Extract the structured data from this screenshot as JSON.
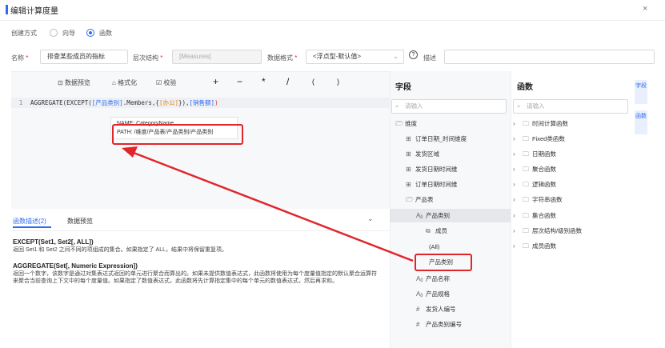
{
  "dialog": {
    "title": "编辑计算度量",
    "close": "×"
  },
  "create_mode": {
    "label": "创建方式",
    "options": [
      {
        "label": "向导",
        "selected": false
      },
      {
        "label": "函数",
        "selected": true
      }
    ]
  },
  "form": {
    "name_label": "名称",
    "name_value": "排查某些成员的指标",
    "hierarchy_label": "层次结构",
    "hierarchy_value": "[Measures]",
    "format_label": "数据格式",
    "format_value": "<浮点型-默认值>",
    "desc_label": "描述",
    "required_mark": "*"
  },
  "toolbar": {
    "preview": "数据预览",
    "format": "格式化",
    "validate": "校验",
    "ops": [
      "+",
      "−",
      "*",
      "/",
      "(",
      ")"
    ]
  },
  "code": {
    "line_no": "1",
    "prefix": "AGGREGATE(EXCEPT(",
    "tok1": "[产品类别]",
    "mid1": ".Members,{",
    "tok2": "[办公]",
    "mid2": "}),",
    "tok3": "[销售额]",
    "suffix": ")"
  },
  "popup": {
    "name_line": "NAME: CategoryName",
    "path_line": "PATH: /维度/产品表/产品类别/产品类别"
  },
  "desc_tabs": {
    "tab1": "函数描述(2)",
    "tab2": "数据预览"
  },
  "descriptions": [
    {
      "head": "EXCEPT(Set1, Set2[, ALL])",
      "body": "返回 Set1 和 Set2 之间不同的项组成的集合。如果指定了 ALL，结果中将保留重复项。"
    },
    {
      "head": "AGGREGATE(Set[, Numeric Expression])",
      "body": "返回一个数字，该数字是通过对集表达式返回的单元进行聚合而算出的。如果未提供数值表达式，此函数将使用为每个度量值指定的默认聚合运算符来聚合当前查询上下文中的每个度量值。如果指定了数值表达式，此函数将先计算指定集中的每个单元的数值表达式，然后再求和。"
    }
  ],
  "fields": {
    "title": "字段",
    "search_placeholder": "请输入",
    "items": [
      {
        "label": "维度",
        "icon": "folder-open-icon"
      },
      {
        "label": "订单日期_时间维度",
        "icon": "hierarchy-icon"
      },
      {
        "label": "发货区域",
        "icon": "hierarchy-icon"
      },
      {
        "label": "发货日期时间维",
        "icon": "hierarchy-icon"
      },
      {
        "label": "订单日期时间维",
        "icon": "hierarchy-icon"
      },
      {
        "label": "产品表",
        "icon": "folder-open-icon"
      },
      {
        "label": "产品类别",
        "icon": "text-field-icon"
      },
      {
        "label": "成员",
        "icon": "member-icon"
      },
      {
        "label": "(All)",
        "icon": ""
      },
      {
        "label": "产品类别",
        "icon": ""
      },
      {
        "label": "产品名称",
        "icon": "text-field-icon"
      },
      {
        "label": "产品规格",
        "icon": "text-field-icon"
      },
      {
        "label": "发货人编号",
        "icon": "hash-icon"
      },
      {
        "label": "产品类别编号",
        "icon": "hash-icon"
      }
    ]
  },
  "functions": {
    "title": "函数",
    "search_placeholder": "请输入",
    "items": [
      "时间计算函数",
      "Fixed类函数",
      "日期函数",
      "聚合函数",
      "逻辑函数",
      "字符串函数",
      "集合函数",
      "层次结构/级别函数",
      "成员函数"
    ]
  },
  "side_tabs": [
    "字段",
    "函数"
  ],
  "colors": {
    "accent": "#2f6bf0",
    "highlight_red": "#e0252b",
    "token_orange": "#e5831a"
  }
}
